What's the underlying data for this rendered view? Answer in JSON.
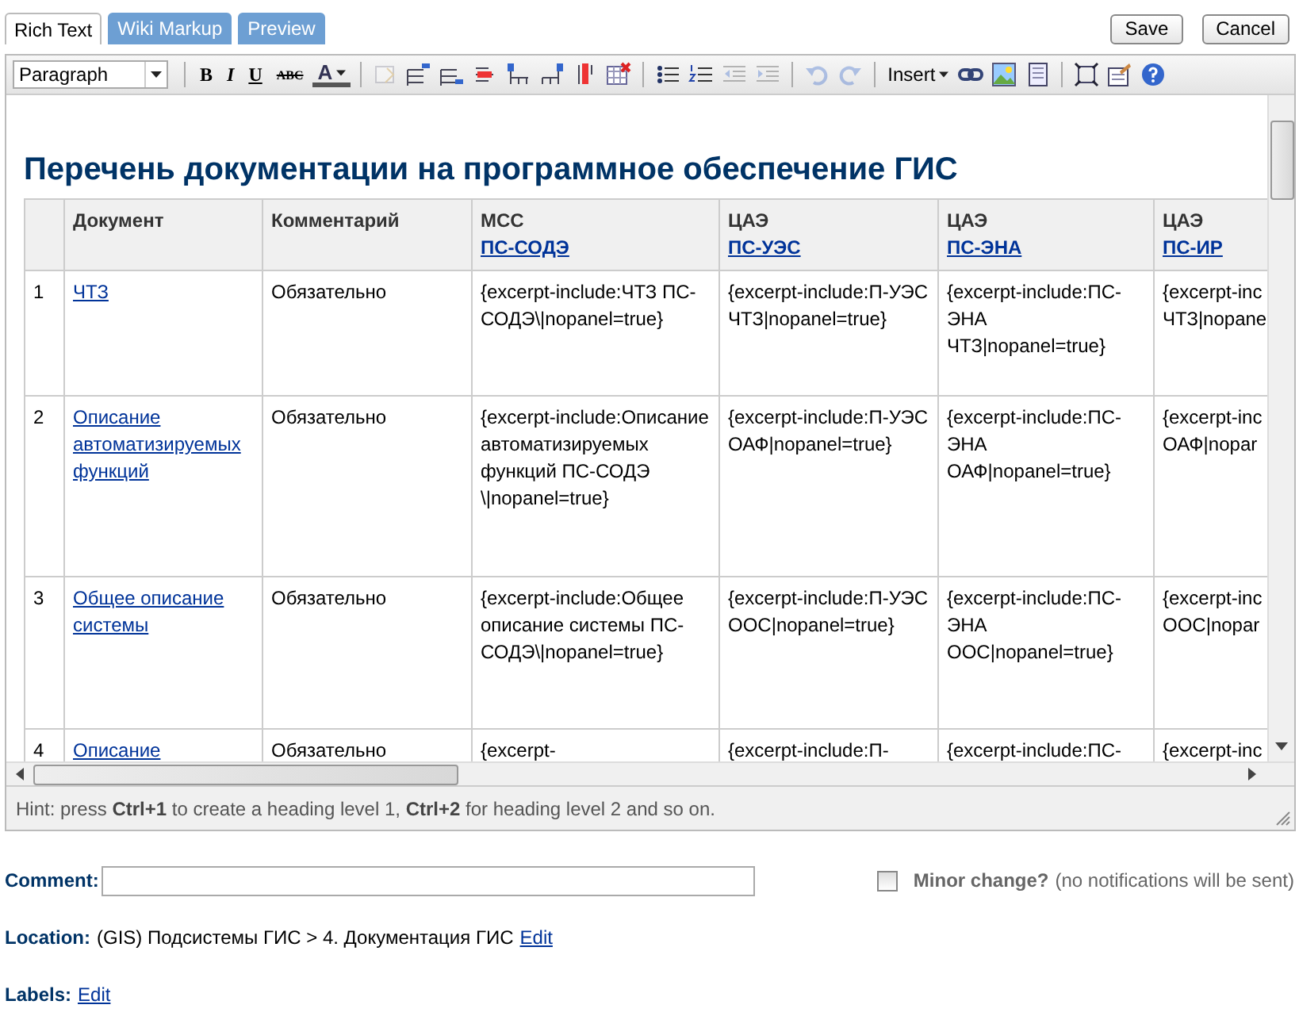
{
  "tabs": [
    {
      "label": "Rich Text",
      "selected": true
    },
    {
      "label": "Wiki Markup",
      "selected": false
    },
    {
      "label": "Preview",
      "selected": false
    }
  ],
  "actions": [
    "Save",
    "Cancel"
  ],
  "toolbar": [
    {
      "kind": "select",
      "label": "Paragraph"
    },
    {
      "kind": "separator"
    },
    {
      "kind": "format",
      "label": "B"
    },
    {
      "kind": "format",
      "label": "I"
    },
    {
      "kind": "format",
      "label": "U"
    },
    {
      "kind": "format",
      "label": "ABC"
    },
    {
      "kind": "format",
      "label": "A"
    },
    {
      "kind": "separator"
    },
    {
      "kind": "icon",
      "disabled": true
    },
    {
      "kind": "icon",
      "disabled": false
    },
    {
      "kind": "icon",
      "disabled": false
    },
    {
      "kind": "icon",
      "disabled": false
    },
    {
      "kind": "icon",
      "disabled": false
    },
    {
      "kind": "icon",
      "disabled": false
    },
    {
      "kind": "icon",
      "disabled": false
    },
    {
      "kind": "icon",
      "disabled": false
    },
    {
      "kind": "separator"
    },
    {
      "kind": "icon",
      "disabled": false
    },
    {
      "kind": "icon",
      "disabled": false
    },
    {
      "kind": "icon",
      "disabled": true
    },
    {
      "kind": "icon",
      "disabled": true
    },
    {
      "kind": "separator"
    },
    {
      "kind": "icon",
      "disabled": true
    },
    {
      "kind": "icon",
      "disabled": true
    },
    {
      "kind": "separator"
    },
    {
      "kind": "menu",
      "label": "Insert"
    },
    {
      "kind": "icon",
      "disabled": false
    },
    {
      "kind": "icon",
      "disabled": false
    },
    {
      "kind": "icon",
      "disabled": false
    },
    {
      "kind": "separator"
    },
    {
      "kind": "icon",
      "disabled": false
    },
    {
      "kind": "icon",
      "disabled": false
    },
    {
      "kind": "icon",
      "disabled": false
    }
  ],
  "document": {
    "heading": "Перечень документации на программное обеспечение ГИС",
    "columns": [
      {},
      {
        "title": "Документ"
      },
      {
        "title": "Комментарий"
      },
      {
        "title": "МСС",
        "link": "ПС-СОДЭ"
      },
      {
        "title": "ЦАЭ",
        "link": "ПС-УЭС"
      },
      {
        "title": "ЦАЭ",
        "link": "ПС-ЭНА"
      },
      {
        "title": "ЦАЭ",
        "link": "ПС-ИР"
      }
    ],
    "rows": [
      {
        "number": "1",
        "document": "ЧТЗ",
        "comment": "Обязательно",
        "values": [
          "{excerpt-include:ЧТЗ ПС-СОДЭ\\|nopanel=true}",
          "{excerpt-include:П-УЭС ЧТЗ|nopanel=true}",
          "{excerpt-include:ПС-ЭНА ЧТЗ|nopanel=true}",
          "{excerpt-inc ЧТЗ|nopane"
        ]
      },
      {
        "number": "2",
        "document": "Описание автоматизируемых функций",
        "comment": "Обязательно",
        "values": [
          "{excerpt-include:Описание автоматизируемых функций ПС-СОДЭ \\|nopanel=true}",
          "{excerpt-include:П-УЭС ОАФ|nopanel=true}",
          "{excerpt-include:ПС-ЭНА ОАФ|nopanel=true}",
          "{excerpt-inc ОАФ|nopar"
        ]
      },
      {
        "number": "3",
        "document": "Общее описание системы",
        "comment": "Обязательно",
        "values": [
          "{excerpt-include:Общее описание системы ПС-СОДЭ\\|nopanel=true}",
          "{excerpt-include:П-УЭС ООС|nopanel=true}",
          "{excerpt-include:ПС-ЭНА ООС|nopanel=true}",
          "{excerpt-inc ООС|nopar"
        ]
      },
      {
        "number": "4",
        "document": "Описание",
        "comment": "Обязательно",
        "values": [
          "{excerpt-",
          "{excerpt-include:П-",
          "{excerpt-include:ПС-",
          "{excerpt-inc"
        ]
      }
    ]
  },
  "hint": "Hint: press **Ctrl+1** to create a heading level 1, **Ctrl+2** for heading level 2 and so on.",
  "comment": {
    "label": "Comment:"
  },
  "minor_change": {
    "label": "Minor change?",
    "note": "(no notifications will be sent)",
    "checked": false
  },
  "location": {
    "label": "Location:",
    "text": "(GIS) Подсистемы ГИС > 4. Документация ГИС",
    "link": "Edit"
  },
  "labels": {
    "label": "Labels:",
    "link": "Edit"
  }
}
